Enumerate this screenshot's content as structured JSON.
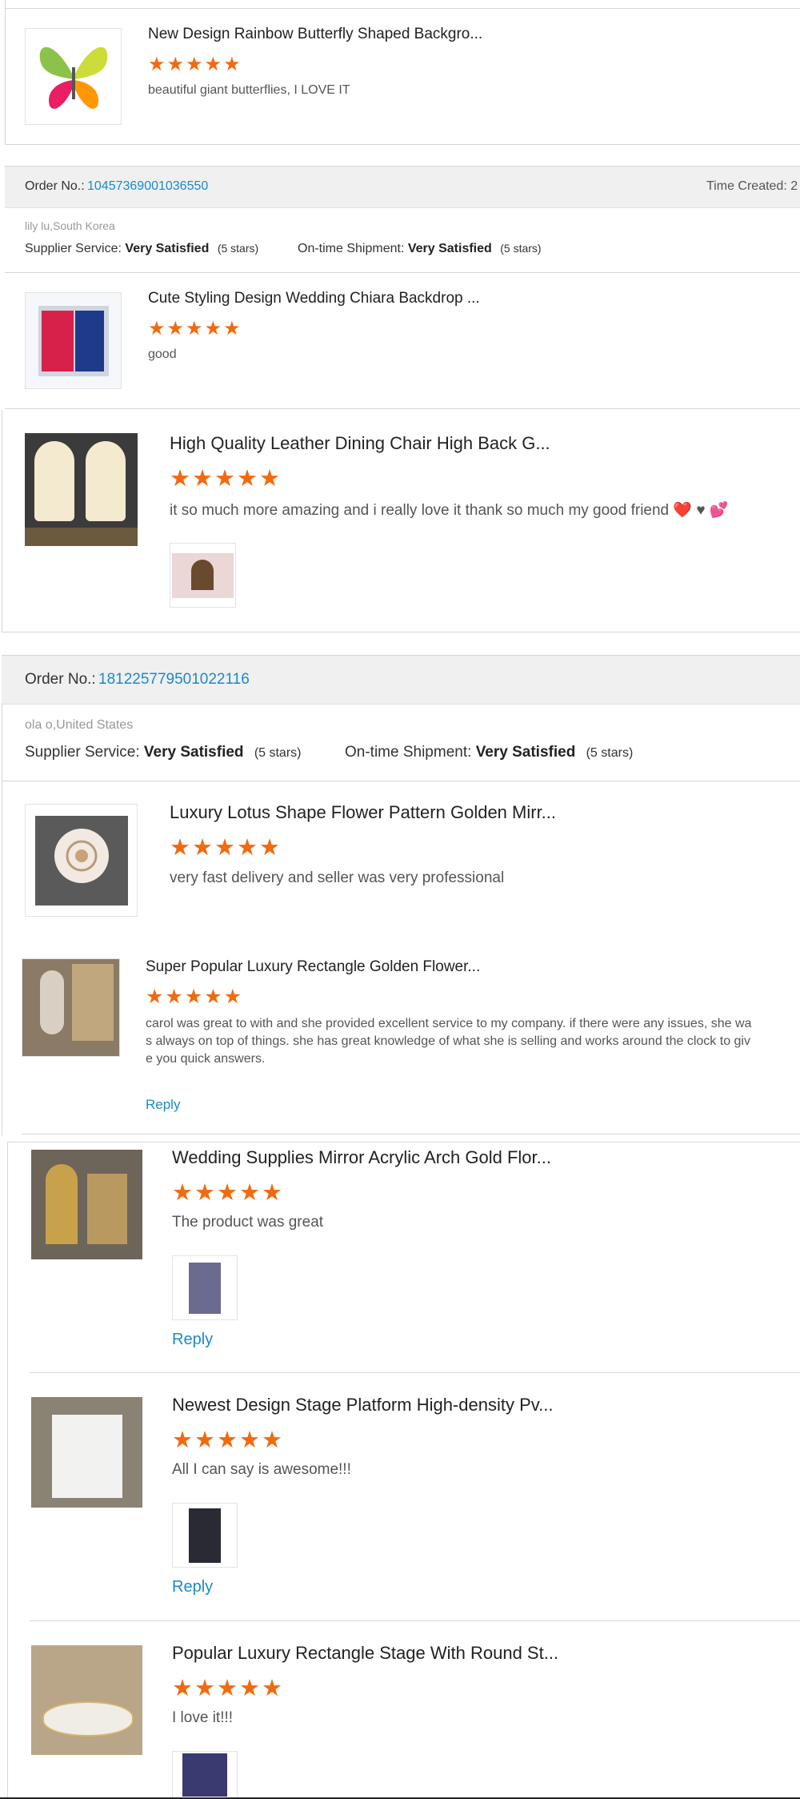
{
  "colors": {
    "accent": "#f26a10",
    "link": "#1a8acc"
  },
  "blocks": [
    {
      "title": "New Design Rainbow Butterfly Shaped Backgro...",
      "stars": "★★★★★",
      "review": "beautiful giant butterflies, I LOVE IT"
    },
    {
      "title": "Cute Styling Design Wedding Chiara Backdrop ...",
      "stars": "★★★★★",
      "review": "good"
    },
    {
      "title": "High Quality Leather Dining Chair High Back G...",
      "stars": "★★★★★",
      "review": "it so much more amazing and i really love it thank so much my good friend ❤️ ♥ 💕"
    },
    {
      "title": "Luxury Lotus Shape Flower Pattern Golden Mirr...",
      "stars": "★★★★★",
      "review": "very fast delivery and seller was very professional"
    },
    {
      "title": "Super Popular Luxury Rectangle Golden Flower...",
      "stars": "★★★★★",
      "review_lines": [
        "carol was great to with and she provided excellent service to my company. if there were any issues, she wa",
        "s always on top of things. she has great knowledge of what she is selling and works around the clock to giv",
        "e you quick answers."
      ],
      "reply": "Reply"
    },
    {
      "title": "Wedding Supplies Mirror Acrylic Arch Gold Flor...",
      "stars": "★★★★★",
      "review": "The product was great",
      "reply": "Reply"
    },
    {
      "title": "Newest Design Stage Platform High-density Pv...",
      "stars": "★★★★★",
      "review": "All I can say is awesome!!!",
      "reply": "Reply"
    },
    {
      "title": "Popular Luxury Rectangle Stage With Round St...",
      "stars": "★★★★★",
      "review": "I love it!!!"
    }
  ],
  "orders": [
    {
      "label": "Order No.:",
      "number": "10457369001036550",
      "time_label": "Time Created: 2",
      "buyer": "lily lu,South Korea",
      "supplier_label": "Supplier Service:",
      "supplier_value": "Very Satisfied",
      "supplier_stars": "(5 stars)",
      "shipment_label": "On-time Shipment:",
      "shipment_value": "Very Satisfied",
      "shipment_stars": "(5 stars)"
    },
    {
      "label": "Order No.:",
      "number": "181225779501022116",
      "buyer": "ola o,United States",
      "supplier_label": "Supplier Service:",
      "supplier_value": "Very Satisfied",
      "supplier_stars": "(5 stars)",
      "shipment_label": "On-time Shipment:",
      "shipment_value": "Very Satisfied",
      "shipment_stars": "(5 stars)"
    }
  ]
}
